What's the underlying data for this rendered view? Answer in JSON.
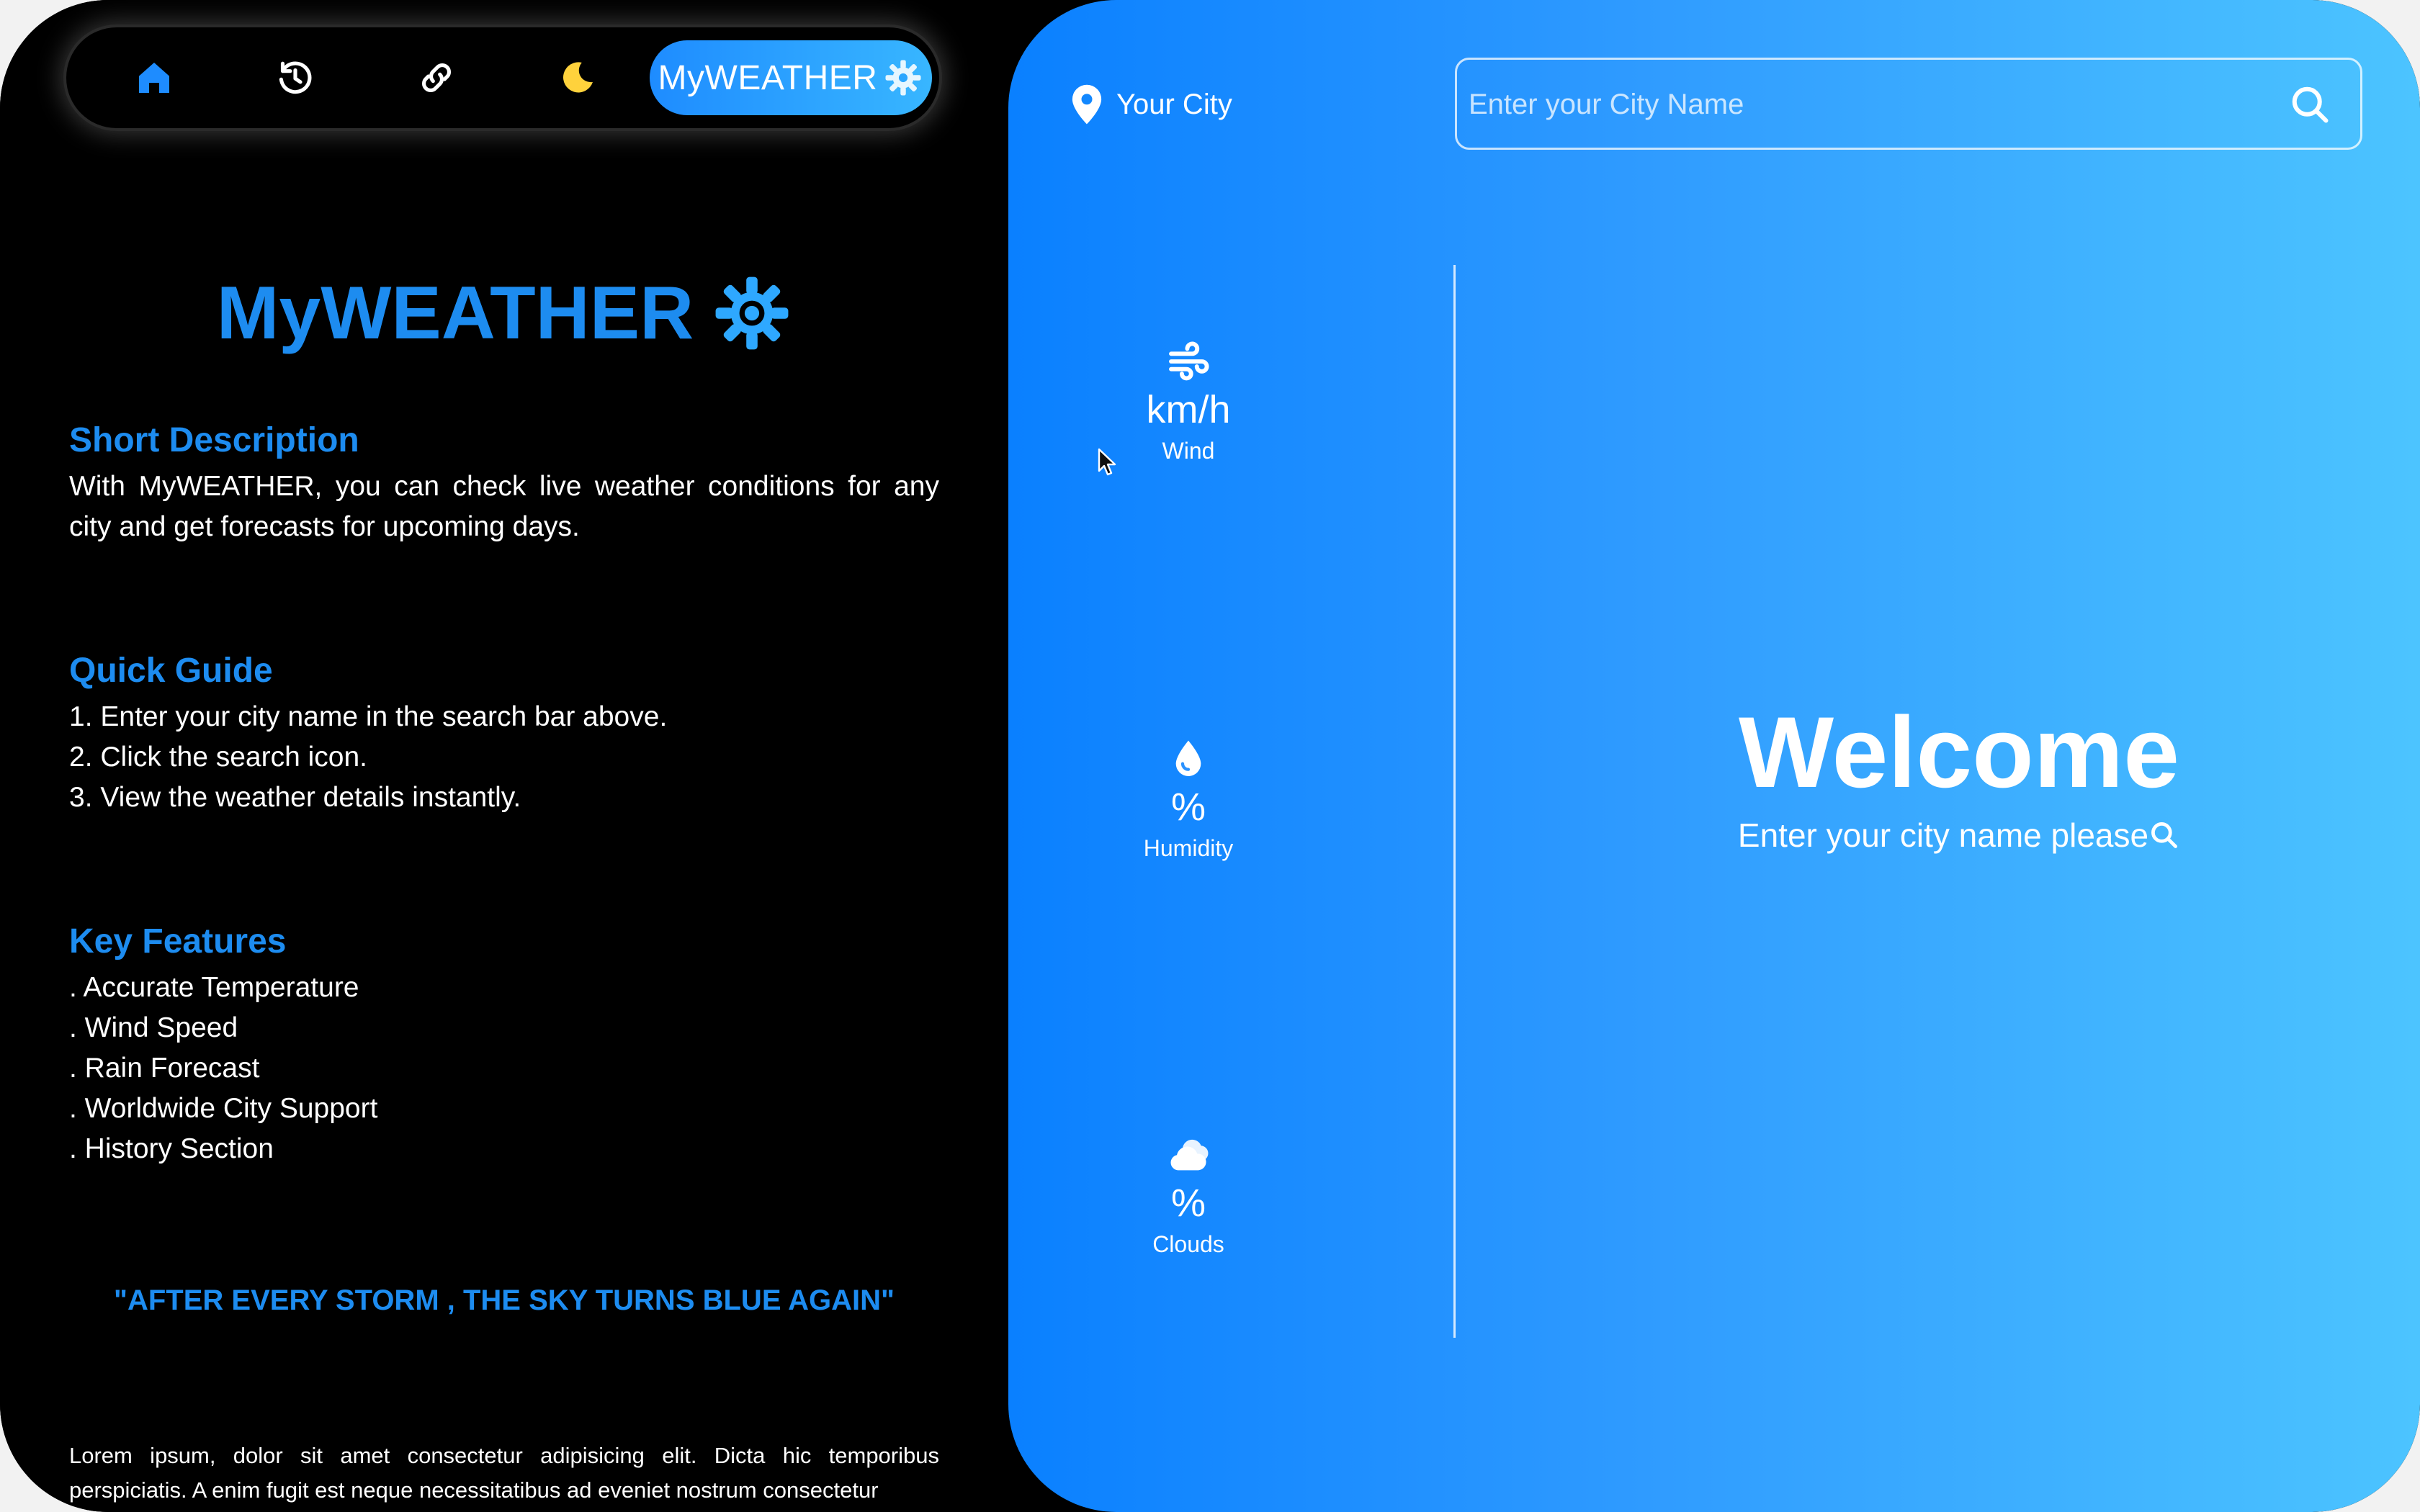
{
  "nav": {
    "icons": [
      "home-icon",
      "history-icon",
      "link-icon",
      "moon-icon"
    ],
    "brand": "MyWEATHER",
    "colors": {
      "home": "#1e8cff",
      "moon": "#ffd23c",
      "brand_gradient_start": "#1e8cff",
      "brand_gradient_end": "#38b6ff"
    }
  },
  "left": {
    "title": "MyWEATHER",
    "short_description": {
      "heading": "Short Description",
      "text": "With MyWEATHER, you can check live weather conditions for any city and get forecasts for upcoming days."
    },
    "quick_guide": {
      "heading": "Quick Guide",
      "steps": [
        "1. Enter your city name in the search bar above.",
        "2. Click the search icon.",
        "3. View the weather details instantly."
      ]
    },
    "key_features": {
      "heading": "Key Features",
      "items": [
        ". Accurate Temperature",
        ". Wind Speed",
        ". Rain Forecast",
        ". Worldwide City Support",
        ". History Section"
      ]
    },
    "quote": "\"AFTER EVERY STORM , THE SKY TURNS BLUE AGAIN\"",
    "lorem": "Lorem ipsum, dolor sit amet consectetur adipisicing elit. Dicta hic temporibus perspiciatis. A enim fugit est neque necessitatibus ad eveniet nostrum consectetur"
  },
  "right": {
    "location_label": "Your City",
    "search": {
      "placeholder": "Enter your City Name",
      "value": ""
    },
    "stats": {
      "wind": {
        "value": "km/h",
        "label": "Wind"
      },
      "humidity": {
        "value": "%",
        "label": "Humidity"
      },
      "clouds": {
        "value": "%",
        "label": "Clouds"
      }
    },
    "welcome": {
      "title": "Welcome",
      "subtitle": "Enter your city name please"
    },
    "colors": {
      "gradient_start": "#0a80ff",
      "gradient_end": "#4cc4ff",
      "accent_text": "#1d8cf0"
    }
  }
}
